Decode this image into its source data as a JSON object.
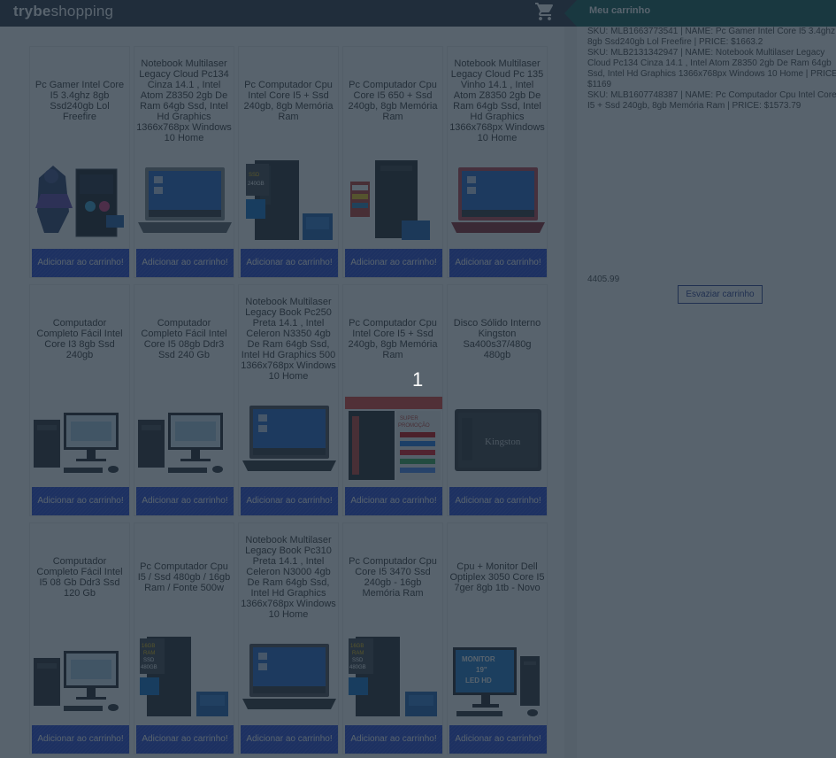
{
  "header": {
    "logo_part1": "trybe",
    "logo_part2": "shopping",
    "cart_title": "Meu carrinho",
    "cart_icon": "shopping-cart-icon"
  },
  "button_label": "Adicionar ao carrinho!",
  "products": [
    {
      "name": "Pc Gamer Intel Core I5 3.4ghz 8gb Ssd240gb Lol Freefire",
      "image": "gamer-pc"
    },
    {
      "name": "Notebook Multilaser Legacy Cloud Pc134 Cinza 14.1 , Intel Atom Z8350 2gb De Ram 64gb Ssd, Intel Hd Graphics 1366x768px Windows 10 Home",
      "image": "notebook-gray"
    },
    {
      "name": "Pc Computador Cpu Intel Core I5 + Ssd 240gb, 8gb Memória Ram",
      "image": "tower-ssd"
    },
    {
      "name": "Pc Computador Cpu Core I5 650 + Ssd 240gb, 8gb Memória Ram",
      "image": "tower-slim"
    },
    {
      "name": "Notebook Multilaser Legacy Cloud Pc 135 Vinho 14.1 , Intel Atom Z8350 2gb De Ram 64gb Ssd, Intel Hd Graphics 1366x768px Windows 10 Home",
      "image": "notebook-red"
    },
    {
      "name": "Computador Completo Fácil Intel Core I3 8gb Ssd 240gb",
      "image": "desktop-kit"
    },
    {
      "name": "Computador Completo Fácil Intel Core I5 08gb Ddr3 Ssd 240 Gb",
      "image": "desktop-kit"
    },
    {
      "name": "Notebook Multilaser Legacy Book Pc250 Preta 14.1 , Intel Celeron N3350 4gb De Ram 64gb Ssd, Intel Hd Graphics 500 1366x768px Windows 10 Home",
      "image": "notebook-black"
    },
    {
      "name": "Pc Computador Cpu Intel Core I5 + Ssd 240gb, 8gb Memória Ram",
      "image": "promo-tower"
    },
    {
      "name": "Disco Sólido Interno Kingston Sa400s37/480g 480gb",
      "image": "ssd-kingston"
    },
    {
      "name": "Computador Completo Fácil Intel I5 08 Gb Ddr3 Ssd 120 Gb",
      "image": "desktop-kit"
    },
    {
      "name": "Pc Computador Cpu I5 / Ssd 480gb / 16gb Ram / Fonte 500w",
      "image": "tower-ram"
    },
    {
      "name": "Notebook Multilaser Legacy Book Pc310 Preta 14.1 , Intel Celeron N3000 4gb De Ram 64gb Ssd, Intel Hd Graphics 1366x768px Windows 10 Home",
      "image": "notebook-black"
    },
    {
      "name": "Pc Computador Cpu Core I5 3470 Ssd 240gb - 16gb Memória Ram",
      "image": "tower-ram"
    },
    {
      "name": "Cpu + Monitor Dell Optiplex 3050 Core I5 7ger 8gb 1tb - Novo",
      "image": "dell-monitor"
    }
  ],
  "image_text": {
    "gamer_brand": "FREE FIRE",
    "ssd_brand": "Kingston",
    "monitor_line1": "MONITOR",
    "monitor_line2": "19\"",
    "monitor_line3": "LED HD",
    "promo_line1": "SUPER",
    "promo_line2": "PROMOÇÃO",
    "ram_label1": "16GB",
    "ram_label2": "RAM",
    "ssd_label": "SSD",
    "ssd_size": "480GB",
    "ssd_size2": "240GB"
  },
  "cart": {
    "items": [
      "SKU: MLB1663773541 | NAME: Pc Gamer Intel Core I5 3.4ghz 8gb Ssd240gb Lol Freefire | PRICE: $1663.2",
      "SKU: MLB2131342947 | NAME: Notebook Multilaser Legacy Cloud Pc134 Cinza 14.1 , Intel Atom Z8350 2gb De Ram 64gb Ssd, Intel Hd Graphics 1366x768px Windows 10 Home | PRICE: $1169",
      "SKU: MLB1607748387 | NAME: Pc Computador Cpu Intel Core I5 + Ssd 240gb, 8gb Memória Ram | PRICE: $1573.79"
    ],
    "total": "4405.99",
    "empty_button": "Esvaziar carrinho"
  },
  "loading": {
    "text": "1"
  }
}
